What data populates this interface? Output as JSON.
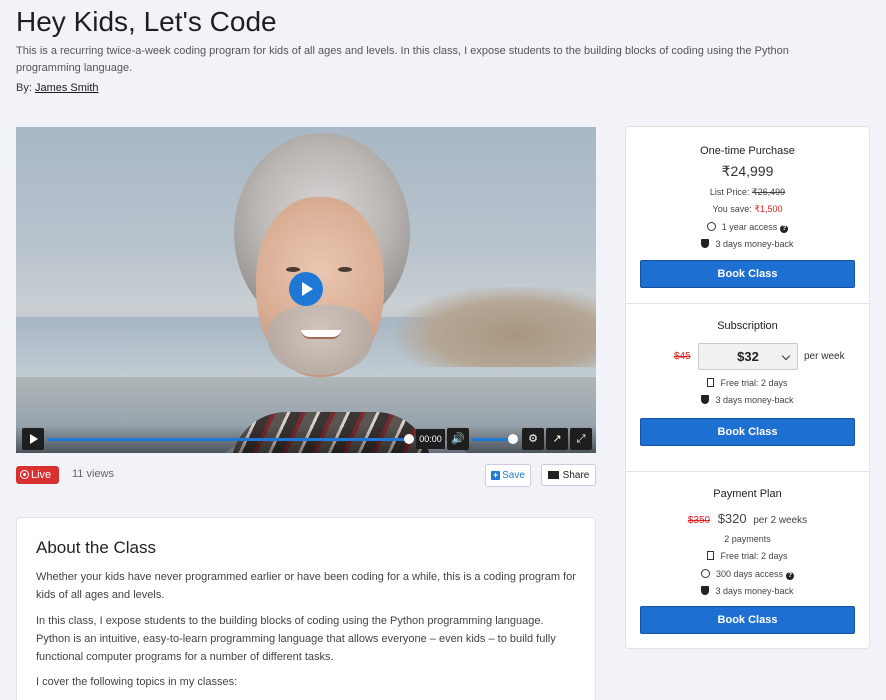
{
  "header": {
    "title": "Hey Kids, Let's Code",
    "description": "This is a recurring twice-a-week coding program for kids of all ages and levels. In this class, I expose students to the building blocks of coding using the Python programming language.",
    "by_label": "By:",
    "author": "James Smith"
  },
  "video": {
    "time": "00:00",
    "progress": 0.0
  },
  "meta": {
    "live_label": "Live",
    "views": "11 views",
    "save_label": "Save",
    "share_label": "Share"
  },
  "about": {
    "title": "About the Class",
    "p1": "Whether your kids have never programmed earlier or have been coding for a while, this is a coding program for kids of all ages and levels.",
    "p2": "In this class, I expose students to the building blocks of coding using the Python programming language. Python is an intuitive, easy-to-learn programming language that allows everyone – even kids – to build fully functional computer programs for a number of different tasks.",
    "p3": "I cover the following topics in my classes:"
  },
  "pricing": {
    "one_time": {
      "title": "One-time Purchase",
      "price": "₹24,999",
      "list_price_label": "List Price:",
      "list_price": "₹26,499",
      "you_save_label": "You save:",
      "you_save": "₹1,500",
      "access": "1 year access",
      "money_back": "3 days money-back",
      "button": "Book Class"
    },
    "subscription": {
      "title": "Subscription",
      "old_price": "$45",
      "price": "$32",
      "period": "per week",
      "free_trial": "Free trial: 2 days",
      "money_back": "3 days money-back",
      "button": "Book Class"
    },
    "payment_plan": {
      "title": "Payment Plan",
      "old_price": "$350",
      "price": "$320",
      "period": "per 2 weeks",
      "payments": "2 payments",
      "free_trial": "Free trial: 2 days",
      "access": "300 days access",
      "money_back": "3 days money-back",
      "button": "Book Class"
    }
  },
  "colors": {
    "accent": "#1d6fd1",
    "live": "#d93131",
    "strike_red": "#e02020"
  }
}
